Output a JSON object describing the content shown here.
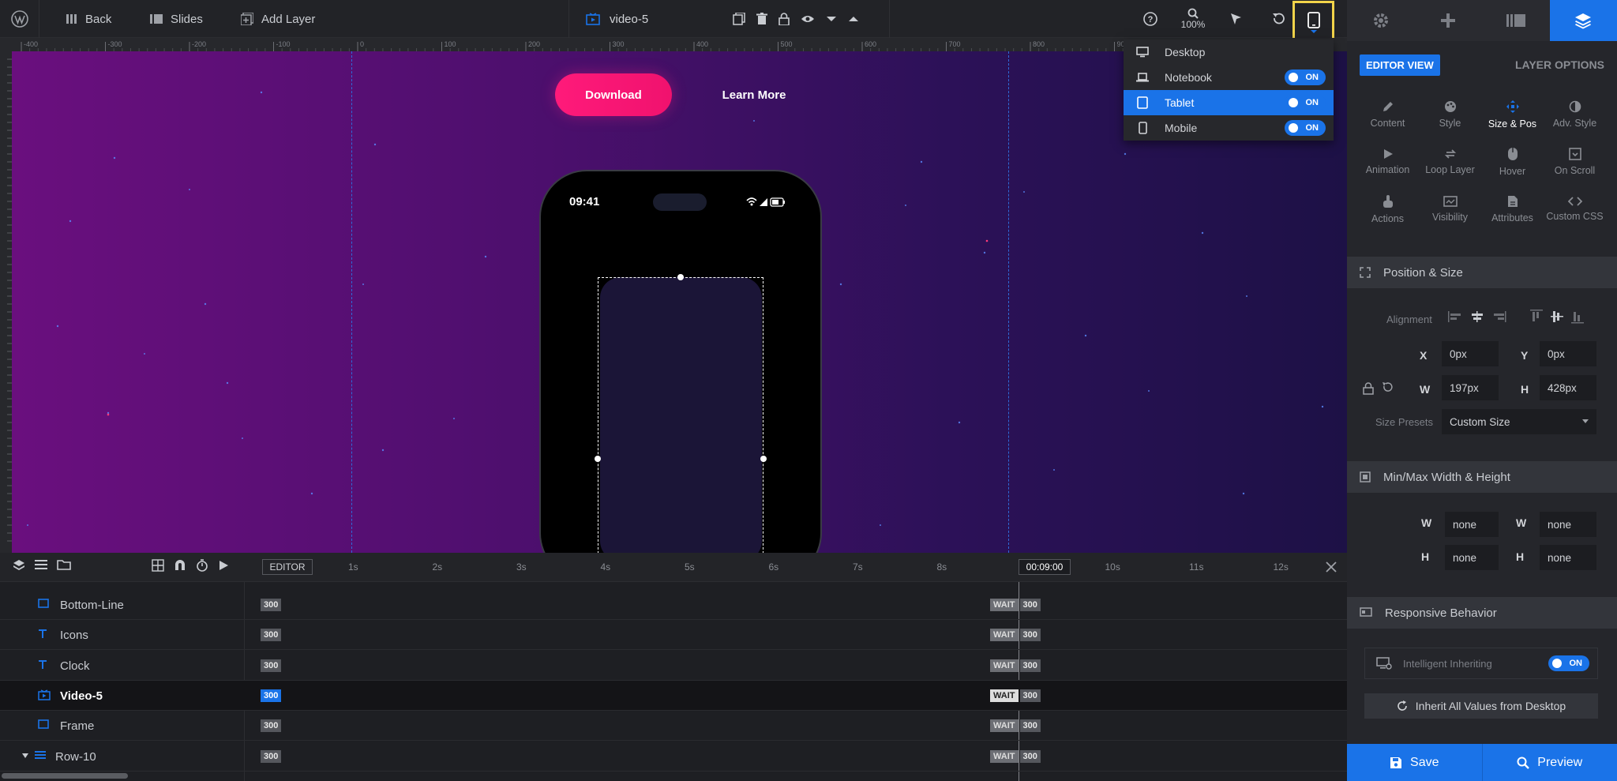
{
  "topbar": {
    "back_label": "Back",
    "slides_label": "Slides",
    "add_layer_label": "Add Layer",
    "layer_name": "video-5",
    "zoom": "100%"
  },
  "device_menu": {
    "items": [
      {
        "label": "Desktop",
        "icon": "desktop-icon",
        "toggle": null
      },
      {
        "label": "Notebook",
        "icon": "laptop-icon",
        "toggle": "ON"
      },
      {
        "label": "Tablet",
        "icon": "tablet-icon",
        "toggle": "ON",
        "selected": true
      },
      {
        "label": "Mobile",
        "icon": "mobile-icon",
        "toggle": "ON"
      }
    ]
  },
  "canvas": {
    "download_label": "Download",
    "learn_more_label": "Learn More",
    "phone_time": "09:41",
    "ruler_ticks": [
      "-400",
      "-300",
      "-200",
      "-100",
      "0",
      "100",
      "200",
      "300",
      "400",
      "500",
      "600",
      "700",
      "800",
      "900"
    ],
    "background_colors": [
      "#6a0f7e",
      "#1d1146"
    ]
  },
  "panel": {
    "editor_view": "EDITOR VIEW",
    "layer_options": "LAYER OPTIONS",
    "categories": [
      {
        "label": "Content",
        "icon": "pencil-icon"
      },
      {
        "label": "Style",
        "icon": "palette-icon"
      },
      {
        "label": "Size & Pos",
        "icon": "move-icon",
        "active": true
      },
      {
        "label": "Adv. Style",
        "icon": "contrast-icon"
      },
      {
        "label": "Animation",
        "icon": "play-icon"
      },
      {
        "label": "Loop Layer",
        "icon": "loop-icon"
      },
      {
        "label": "Hover",
        "icon": "mouse-icon"
      },
      {
        "label": "On Scroll",
        "icon": "scroll-icon"
      },
      {
        "label": "Actions",
        "icon": "hand-icon"
      },
      {
        "label": "Visibility",
        "icon": "visibility-icon"
      },
      {
        "label": "Attributes",
        "icon": "file-icon"
      },
      {
        "label": "Custom CSS",
        "icon": "code-icon"
      }
    ],
    "position_size": {
      "title": "Position & Size",
      "alignment_label": "Alignment",
      "x_label": "X",
      "x_value": "0px",
      "y_label": "Y",
      "y_value": "0px",
      "w_label": "W",
      "w_value": "197px",
      "h_label": "H",
      "h_value": "428px",
      "size_presets_label": "Size Presets",
      "size_presets_value": "Custom Size"
    },
    "minmax": {
      "title": "Min/Max Width & Height",
      "min_w": "none",
      "max_w": "none",
      "min_h": "none",
      "max_h": "none"
    },
    "responsive": {
      "title": "Responsive Behavior",
      "intelligent_label": "Intelligent Inheriting",
      "intelligent_toggle": "ON",
      "inherit_button": "Inherit All Values from Desktop"
    },
    "save_label": "Save",
    "preview_label": "Preview"
  },
  "timeline": {
    "editor_label": "EDITOR",
    "current_time": "00:09:00",
    "seconds": [
      "1s",
      "2s",
      "3s",
      "4s",
      "5s",
      "6s",
      "7s",
      "8s",
      "9s",
      "10s",
      "11s",
      "12s"
    ],
    "layers": [
      {
        "name": "Bottom-Line",
        "icon": "shape-icon",
        "start": "300",
        "wait": "WAIT",
        "end": "300"
      },
      {
        "name": "Icons",
        "icon": "text-icon",
        "start": "300",
        "wait": "WAIT",
        "end": "300"
      },
      {
        "name": "Clock",
        "icon": "text-icon",
        "start": "300",
        "wait": "WAIT",
        "end": "300"
      },
      {
        "name": "Video-5",
        "icon": "video-icon",
        "start": "300",
        "wait": "WAIT",
        "end": "300",
        "selected": true
      },
      {
        "name": "Frame",
        "icon": "shape-icon",
        "start": "300",
        "wait": "WAIT",
        "end": "300"
      },
      {
        "name": "Row-10",
        "icon": "row-icon",
        "start": "300",
        "wait": "WAIT",
        "end": "300"
      }
    ]
  },
  "accent_color": "#1a73e8",
  "highlight_color": "#f2d44a"
}
